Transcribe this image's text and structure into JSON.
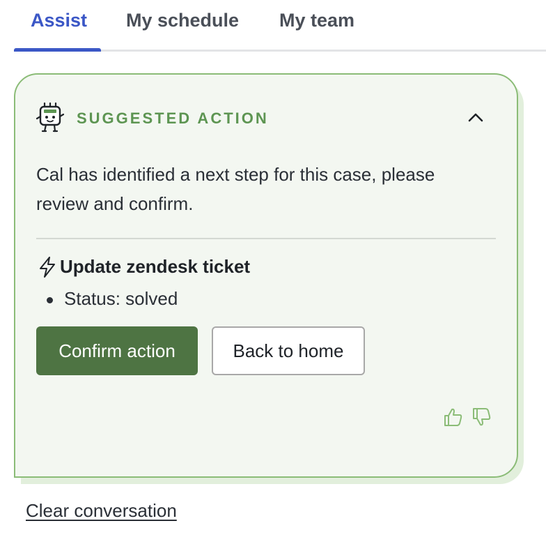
{
  "tabs": [
    {
      "label": "Assist",
      "active": true
    },
    {
      "label": "My schedule",
      "active": false
    },
    {
      "label": "My team",
      "active": false
    }
  ],
  "card": {
    "header": {
      "icon": "robot-icon",
      "title": "SUGGESTED ACTION",
      "collapse_icon": "chevron-up-icon"
    },
    "description": "Cal has identified a next step for this case, please review and confirm.",
    "action": {
      "icon": "lightning-icon",
      "title": "Update zendesk ticket",
      "details": [
        "Status: solved"
      ]
    },
    "buttons": {
      "confirm_label": "Confirm action",
      "back_label": "Back to home"
    },
    "feedback": {
      "thumbs_up_icon": "thumbs-up-icon",
      "thumbs_down_icon": "thumbs-down-icon"
    }
  },
  "footer": {
    "clear_label": "Clear conversation"
  },
  "colors": {
    "accent_blue": "#3b57c6",
    "card_green_border": "#8bbc77",
    "card_bg": "#f3f7f1",
    "header_green": "#5d9552",
    "confirm_button": "#4e7443"
  }
}
